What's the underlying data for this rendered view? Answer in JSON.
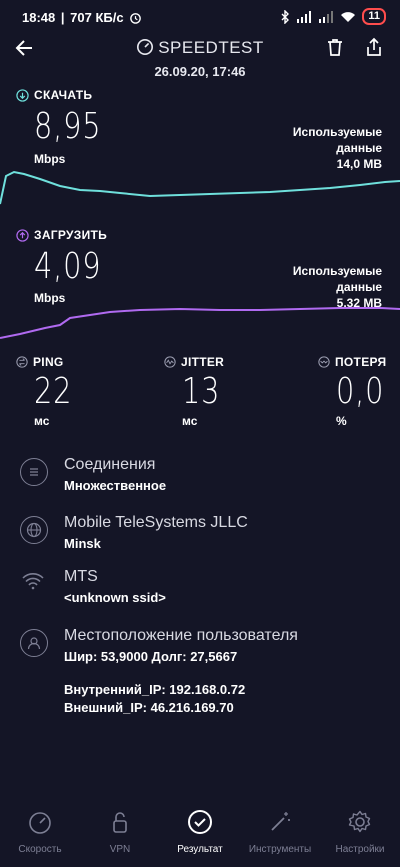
{
  "status": {
    "time": "18:48",
    "speed": "707 КБ/с",
    "battery": "11"
  },
  "header": {
    "title": "SPEEDTEST",
    "datetime": "26.09.20, 17:46"
  },
  "download": {
    "label": "СКАЧАТЬ",
    "value": "8,95",
    "unit": "Mbps",
    "used_l1": "Используемые",
    "used_l2": "данные",
    "used_amount": "14,0 MB",
    "color": "#6fe0dc"
  },
  "upload": {
    "label": "ЗАГРУЗИТЬ",
    "value": "4,09",
    "unit": "Mbps",
    "used_l1": "Используемые",
    "used_l2": "данные",
    "used_amount": "5,32 MB",
    "color": "#b06af0"
  },
  "metrics": [
    {
      "label": "PING",
      "value": "22",
      "unit": "мс"
    },
    {
      "label": "JITTER",
      "value": "13",
      "unit": "мс"
    },
    {
      "label": "ПОТЕРЯ",
      "value": "0,0",
      "unit": "%"
    }
  ],
  "info": [
    {
      "title": "Соединения",
      "sub": "Множественное"
    },
    {
      "title": "Mobile TeleSystems JLLC",
      "sub": "Minsk"
    },
    {
      "title": "MTS",
      "sub": "<unknown ssid>"
    },
    {
      "title": "Местоположение пользователя",
      "sub": "Шир: 53,9000 Долг: 27,5667"
    }
  ],
  "ip": {
    "internal": "Внутренний_IP: 192.168.0.72",
    "external": "Внешний_IP: 46.216.169.70"
  },
  "nav": [
    {
      "label": "Скорость",
      "icon": "speedometer-icon"
    },
    {
      "label": "VPN",
      "icon": "lock-icon"
    },
    {
      "label": "Результат",
      "icon": "check-icon"
    },
    {
      "label": "Инструменты",
      "icon": "wand-icon"
    },
    {
      "label": "Настройки",
      "icon": "gear-icon"
    }
  ]
}
